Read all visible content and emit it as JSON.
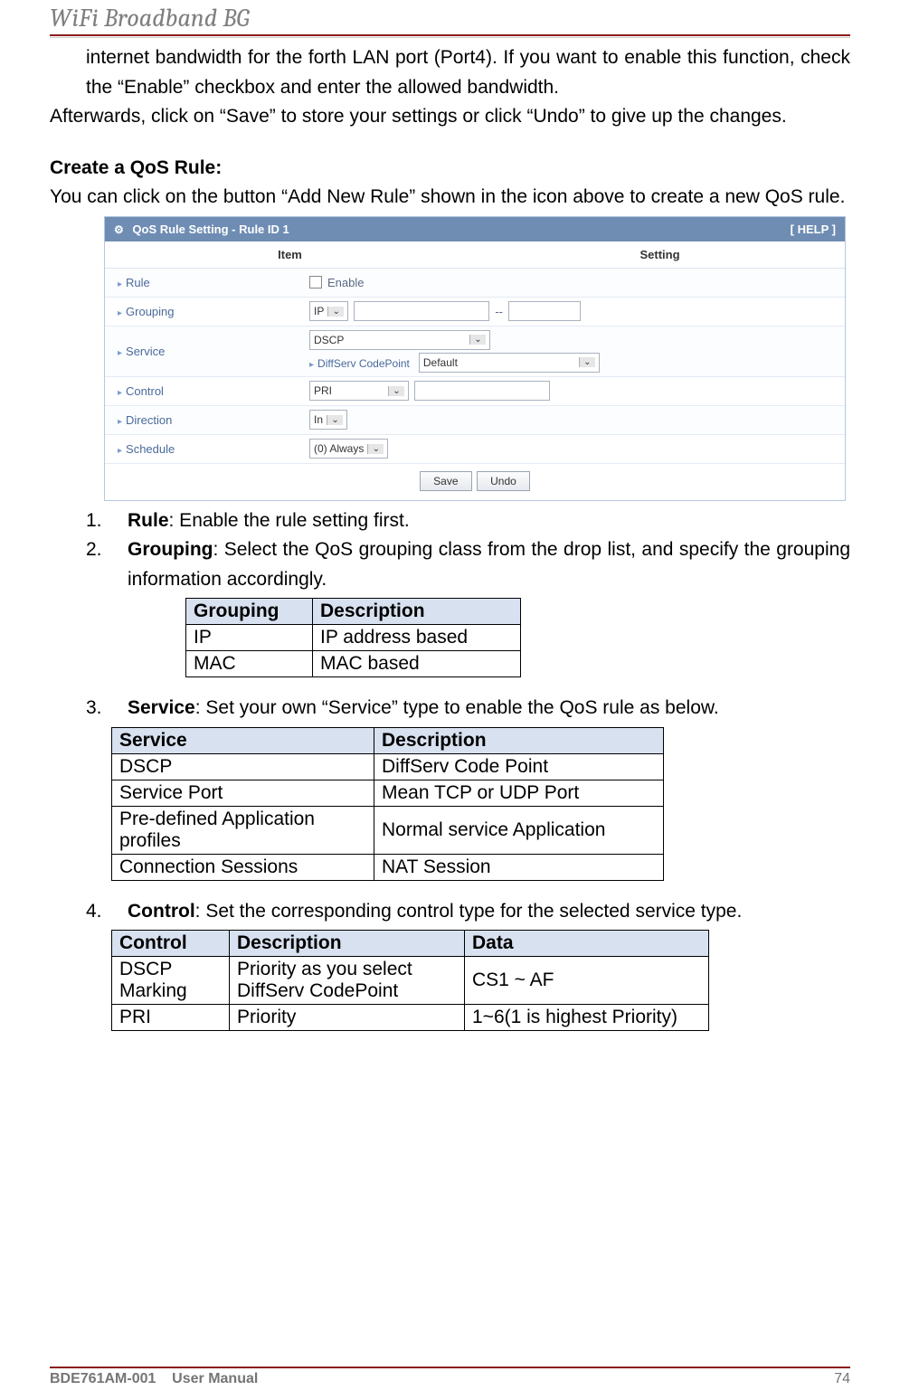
{
  "header": {
    "title": "WiFi Broadband BG"
  },
  "intro": {
    "p1": "internet bandwidth for the forth LAN port (Port4). If you want to enable this function, check the “Enable” checkbox and enter the allowed bandwidth.",
    "p2": "Afterwards, click on “Save” to store your settings or click “Undo” to give up the changes."
  },
  "create": {
    "heading": "Create a QoS Rule:",
    "body": "You can click on the button “Add New Rule” shown in the icon above to create a new QoS rule."
  },
  "shot": {
    "title": "QoS Rule Setting - Rule ID 1",
    "help": "[ HELP ]",
    "col_item": "Item",
    "col_setting": "Setting",
    "rows": {
      "rule": "Rule",
      "rule_enable": "Enable",
      "grouping": "Grouping",
      "grouping_sel": "IP",
      "service": "Service",
      "service_sel": "DSCP",
      "service_sub": "DiffServ CodePoint",
      "service_sub_val": "Default",
      "control": "Control",
      "control_sel": "PRI",
      "direction": "Direction",
      "direction_sel": "In",
      "schedule": "Schedule",
      "schedule_sel": "(0) Always"
    },
    "btn_save": "Save",
    "btn_undo": "Undo"
  },
  "list": {
    "i1_num": "1.",
    "i1_label": "Rule",
    "i1_rest": ": Enable the rule setting first.",
    "i2_num": "2.",
    "i2_label": "Grouping",
    "i2_rest": ": Select the QoS grouping class from the drop list, and specify the grouping information accordingly.",
    "i3_num": "3.",
    "i3_label": "Service",
    "i3_rest": ": Set your own “Service” type to enable the QoS rule as below.",
    "i4_num": "4.",
    "i4_label": "Control",
    "i4_rest": ": Set the corresponding control type for the selected service type."
  },
  "t_group": {
    "h1": "Grouping",
    "h2": "Description",
    "r1c1": "IP",
    "r1c2": "IP address based",
    "r2c1": "MAC",
    "r2c2": "MAC based"
  },
  "t_service": {
    "h1": "Service",
    "h2": "Description",
    "r1c1": "DSCP",
    "r1c2": "DiffServ Code Point",
    "r2c1": "Service Port",
    "r2c2": "Mean TCP or UDP Port",
    "r3c1": "Pre-defined Application profiles",
    "r3c2": "Normal service Application",
    "r4c1": "Connection Sessions",
    "r4c2": "NAT Session"
  },
  "t_control": {
    "h1": "Control",
    "h2": "Description",
    "h3": "Data",
    "r1c1": "DSCP Marking",
    "r1c2": "Priority as you select DiffServ CodePoint",
    "r1c3": "CS1 ~ AF",
    "r2c1": "PRI",
    "r2c2": "Priority",
    "r2c3": "1~6(1 is highest Priority)"
  },
  "footer": {
    "left_a": "BDE761AM-001",
    "left_b": "User Manual",
    "right": "74"
  }
}
